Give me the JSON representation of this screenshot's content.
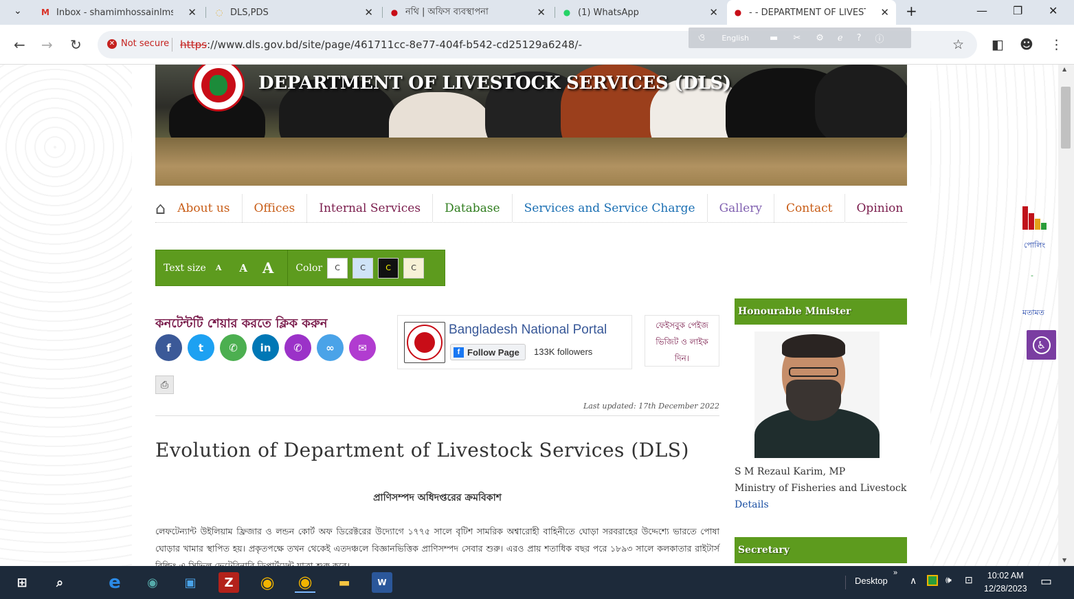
{
  "browser": {
    "tabs": [
      {
        "title": "Inbox - shamimhossainlms@",
        "icon": "gmail-icon"
      },
      {
        "title": "DLS,PDS",
        "icon": "spinner-icon"
      },
      {
        "title": "নথি | অফিস ব্যবস্থাপনা",
        "icon": "nothi-icon"
      },
      {
        "title": "(1) WhatsApp",
        "icon": "whatsapp-icon"
      },
      {
        "title": "- - DEPARTMENT OF LIVESTO",
        "icon": "dls-icon"
      }
    ],
    "security_label": "Not secure",
    "url_scheme": "https",
    "url_rest": "://www.dls.gov.bd/site/page/461711cc-8e77-404f-b542-cd25129a6248/-",
    "translate_lang": "English"
  },
  "banner": {
    "title": "DEPARTMENT OF LIVESTOCK SERVICES (DLS)"
  },
  "menu": [
    {
      "label": "About us",
      "color": "#c85d17"
    },
    {
      "label": "Offices",
      "color": "#c85d17"
    },
    {
      "label": "Internal Services",
      "color": "#7a1c4c"
    },
    {
      "label": "Database",
      "color": "#2f7d1e"
    },
    {
      "label": "Services and Service Charge",
      "color": "#1a6fb3"
    },
    {
      "label": "Gallery",
      "color": "#8060b0"
    },
    {
      "label": "Contact",
      "color": "#c85d17"
    },
    {
      "label": "Opinion",
      "color": "#7a1c4c"
    }
  ],
  "textsize": {
    "label": "Text size",
    "small": "A",
    "medium": "A",
    "large": "A",
    "color_label": "Color",
    "color_btn": "C"
  },
  "share": {
    "title": "কনটেন্টটি শেয়ার করতে ক্লিক করুন"
  },
  "facebook": {
    "name": "Bangladesh National Portal",
    "follow": "Follow Page",
    "followers": "133K followers"
  },
  "fb_visit": {
    "line1": "ফেইসবুক পেইজ",
    "line2": "ভিজিট ও লাইক",
    "line3": "দিন।"
  },
  "updated": "Last updated: 17th December 2022",
  "article": {
    "title": "Evolution of Department of Livestock Services (DLS)",
    "subtitle": "প্রাণিসম্পদ অধিদপ্তরের ক্রমবিকাশ",
    "para1": "লেফটেন্যান্ট উইলিয়াম ফ্রিজার ও লন্ডন কোর্ট অফ ডিরেক্টরের উদ্যোগে ১৭৭৫ সালে বৃটিশ সামরিক অশ্বারোহী বাহিনীতে ঘোড়া সরবরাহের উদ্দেশ্যে ভারতে পোষা ঘোড়ার খামার স্থাপিত হয়। প্রকৃতপক্ষে তখন থেকেই এতদঞ্চলে বিজ্ঞানভিত্তিক প্রাণিসম্পদ সেবার শুরু। এরও প্রায় শতাধিক বছর পরে ১৮৯৩ সালে কলকাতার রাইটার্স বিল্ডিং-এ সিভিল ভেটেরিনারি ডিপার্টমেন্ট যাত্রা শুরু করে।"
  },
  "sidebar": {
    "minister_head": "Honourable Minister",
    "minister_name": "S M Rezaul Karim, MP",
    "minister_ministry": "Ministry of Fisheries and Livestock",
    "details": "Details",
    "secretary_head": "Secretary"
  },
  "right_widgets": {
    "poll": "পোলিং",
    "opinion": "মতামত"
  },
  "taskbar": {
    "desktop": "Desktop",
    "time": "10:02 AM",
    "date": "12/28/2023"
  }
}
